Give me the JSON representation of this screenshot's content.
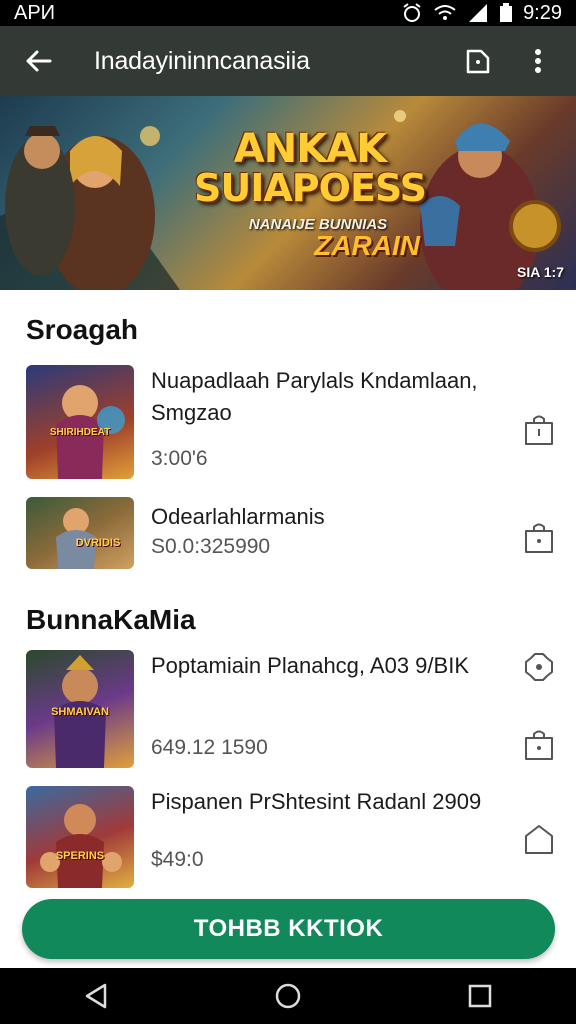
{
  "status_bar": {
    "left": "АРИ",
    "time": "9:29"
  },
  "app_bar": {
    "title": "Inadayininncanasiia"
  },
  "banner": {
    "title_line1": "ANKAK",
    "title_line2": "SUIAPOESS",
    "subtitle": "NANAIJE BUNNIAS",
    "subtitle2": "ZARAIN",
    "badge": "SIA 1:7"
  },
  "sections": [
    {
      "title": "Sroagah",
      "items": [
        {
          "name": "Nuapadlaah Parylals Kndamlaan, Smgzao",
          "price": "3:00'6",
          "thumb_label": "SHIRIHDEAT"
        },
        {
          "name": "Odearlahlarmanis",
          "price": "S0.0:325990",
          "thumb_label": "DVRIDIS"
        }
      ]
    },
    {
      "title": "BunnaKaMia",
      "items": [
        {
          "name": "Poptamiain Planahcg, A03 9/BIK",
          "price": "649.12 1590",
          "thumb_label": "SHMAIVAN"
        },
        {
          "name": "Pispanen PrShtesint Radanl 2909",
          "price": "$49:0",
          "thumb_label": "SPERINS"
        }
      ]
    }
  ],
  "cta": {
    "label": "TOHBB KKTIOK"
  },
  "icons": {
    "back": "arrow-left-icon",
    "share": "share-box-icon",
    "more": "more-vertical-icon",
    "item_action": "bag-icon"
  },
  "colors": {
    "app_bar": "#333a36",
    "cta": "#11895a"
  }
}
